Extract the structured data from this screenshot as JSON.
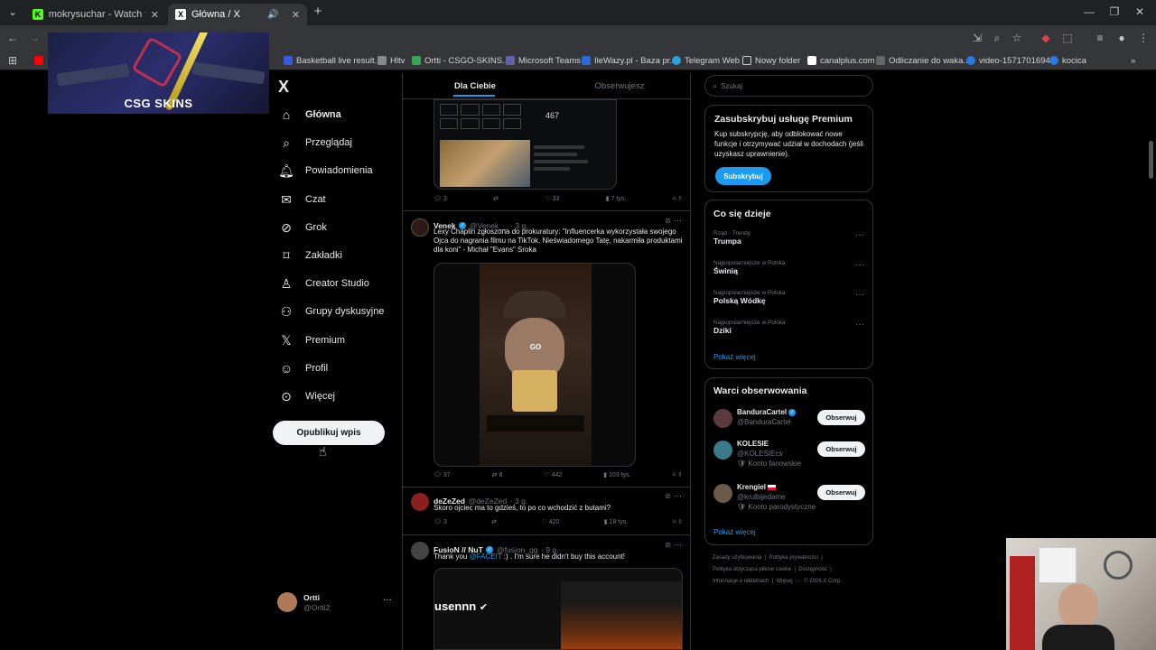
{
  "browser": {
    "tabs": [
      {
        "title": "mokrysuchar - Watch the VOD",
        "favicon": "kick-icon"
      },
      {
        "title": "Główna / X",
        "favicon": "x-icon"
      }
    ],
    "new_tab_label": "+",
    "bookmarks": [
      "Basketball live result...",
      "Hltv",
      "Ortti - CSGO-SKINS...",
      "Microsoft Teams",
      "IleWazy.pl - Baza pr...",
      "Telegram Web",
      "Nowy folder",
      "canalplus.com",
      "Odliczanie do waka...",
      "video-1571701694",
      "kocica"
    ],
    "more_bookmarks": "»"
  },
  "overlay": {
    "logo_text": "CSG SKINS"
  },
  "sidebar": {
    "logo": "X",
    "items": [
      {
        "label": "Główna",
        "icon": "home-icon"
      },
      {
        "label": "Przeglądaj",
        "icon": "search-icon"
      },
      {
        "label": "Powiadomienia",
        "icon": "bell-icon"
      },
      {
        "label": "Czat",
        "icon": "mail-icon"
      },
      {
        "label": "Grok",
        "icon": "grok-icon"
      },
      {
        "label": "Zakładki",
        "icon": "bookmark-icon"
      },
      {
        "label": "Creator Studio",
        "icon": "creator-icon"
      },
      {
        "label": "Grupy dyskusyjne",
        "icon": "groups-icon"
      },
      {
        "label": "Premium",
        "icon": "x-icon"
      },
      {
        "label": "Profil",
        "icon": "person-icon"
      },
      {
        "label": "Więcej",
        "icon": "more-circle-icon"
      }
    ],
    "post_button": "Opublikuj wpis",
    "account": {
      "name": "Ortti",
      "handle": "@Ortti2",
      "menu": "···"
    }
  },
  "feed": {
    "tabs": [
      "Dla Ciebie",
      "Obserwujesz"
    ],
    "tweet0": {
      "embedded_counter": "467",
      "actions": [
        "3",
        "",
        "33",
        "7 tys."
      ]
    },
    "tweet1": {
      "name": "Venek",
      "handle": "@Venek__",
      "time": "· 3 g.",
      "text": "Lexy Chaplin zgłoszona do prokuratury: \"Influencerka wykorzystała swojego Ojca do nagrania filmu na TikTok. Nieświadomego Tatę, nakarmiła produktami dla koni\" - Michał \"Evans\" Sroka",
      "video_overlay": "GO",
      "actions": [
        "37",
        "8",
        "442",
        "103 tys."
      ]
    },
    "tweet2": {
      "name": "deZeZed",
      "handle": "@deZeZed",
      "time": "· 3 g.",
      "text": "Skoro ojciec ma to gdzieś, to po co wchodzić z butami?",
      "actions": [
        "3",
        "",
        "420",
        "18 tys."
      ]
    },
    "tweet3": {
      "name": "FusioN // NuT",
      "handle": "@fusion_gg",
      "time": "· 9 g.",
      "text_prefix": "Thank you ",
      "mention": "@FACEIT",
      "text_suffix": " :) . I'm sure he didn't buy this account!",
      "image_text": "usennn"
    }
  },
  "right": {
    "search_placeholder": "Szukaj",
    "premium": {
      "title": "Zasubskrybuj usługę Premium",
      "text": "Kup subskrypcję, aby odblokować nowe funkcje i otrzymywać udział w dochodach (jeśli uzyskasz uprawnienie).",
      "button": "Subskrybuj"
    },
    "trends": {
      "title": "Co się dzieje",
      "items": [
        {
          "meta": "Rząd · Trendy",
          "name": "Trumpa"
        },
        {
          "meta": "Najpopularniejsze w Polska",
          "name": "Świnią"
        },
        {
          "meta": "Najpopularniejsze w Polska",
          "name": "Polską Wódkę"
        },
        {
          "meta": "Najpopularniejsze w Polska",
          "name": "Dziki"
        }
      ],
      "show_more": "Pokaż więcej"
    },
    "follow": {
      "title": "Warci obserwowania",
      "items": [
        {
          "name": "BanduraCartel",
          "handle": "@BanduraCartel",
          "note": "",
          "button": "Obserwuj"
        },
        {
          "name": "KOLESIE",
          "handle": "@KOLESIEcs",
          "note": "Konto fanowskie",
          "button": "Obserwuj"
        },
        {
          "name": "Krengiel",
          "handle": "@krulbijedame",
          "note": "Konto parodystyczne",
          "button": "Obserwuj"
        }
      ],
      "show_more": "Pokaż więcej"
    },
    "footer": [
      "Zasady użytkowania",
      "Polityka prywatności",
      "Polityka dotycząca plików cookie",
      "Dostępność",
      "Informacje o reklamach",
      "Więcej ···",
      "© 2026 X Corp."
    ]
  },
  "colors": {
    "accent": "#1d9bf0",
    "bg": "#000000",
    "border": "#2f3336",
    "muted": "#71767b"
  }
}
